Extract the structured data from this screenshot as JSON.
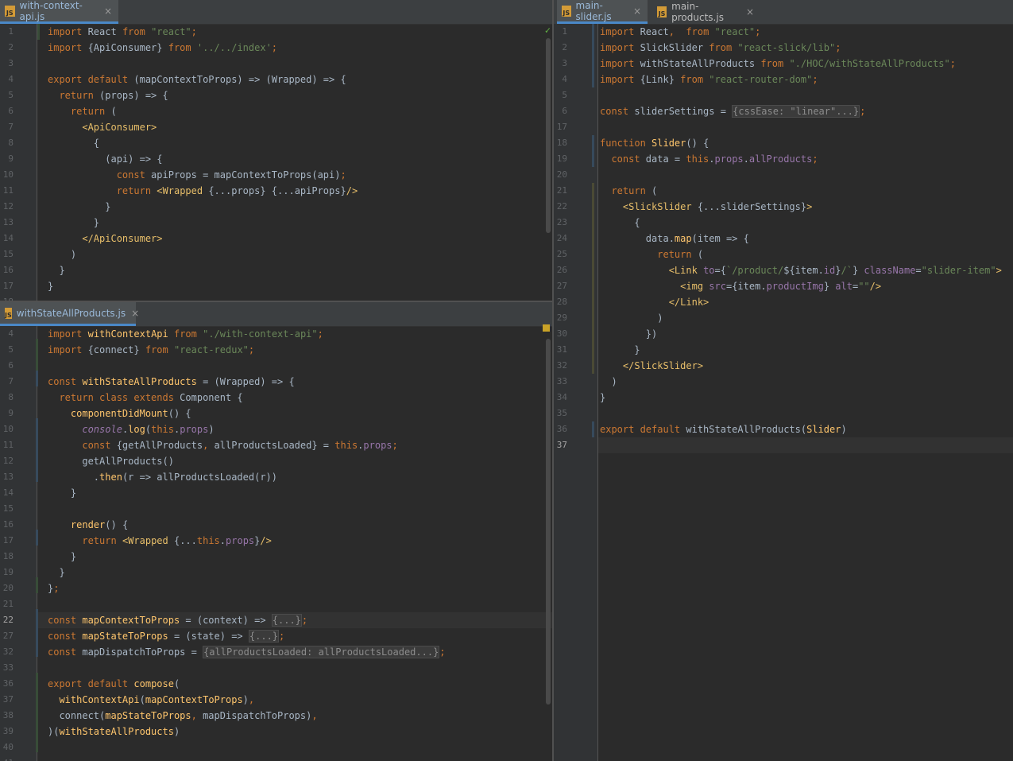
{
  "left_top": {
    "tab": {
      "filename": "with-context-api.js",
      "close": "×"
    },
    "check_mark": "✓",
    "lines": [
      {
        "n": "1",
        "h": "<span class='k'>import</span> React <span class='k'>from</span> <span class='s'>\"react\"</span><span class='k'>;</span>"
      },
      {
        "n": "2",
        "h": "<span class='k'>import</span> {ApiConsumer} <span class='k'>from</span> <span class='s'>'../../index'</span><span class='k'>;</span>"
      },
      {
        "n": "3",
        "h": ""
      },
      {
        "n": "4",
        "h": "<span class='k'>export default</span> (mapContextToProps) => (Wrapped) => {"
      },
      {
        "n": "5",
        "h": "  <span class='k'>return</span> (props) => {"
      },
      {
        "n": "6",
        "h": "    <span class='k'>return</span> ("
      },
      {
        "n": "7",
        "h": "      <span class='t'>&lt;ApiConsumer&gt;</span>"
      },
      {
        "n": "8",
        "h": "        {"
      },
      {
        "n": "9",
        "h": "          (api) => {"
      },
      {
        "n": "10",
        "h": "            <span class='k'>const</span> apiProps = mapContextToProps(api)<span class='k'>;</span>"
      },
      {
        "n": "11",
        "h": "            <span class='k'>return</span> <span class='t'>&lt;Wrapped</span> {...props} {...apiProps}<span class='t'>/&gt;</span>"
      },
      {
        "n": "12",
        "h": "          }"
      },
      {
        "n": "13",
        "h": "        }"
      },
      {
        "n": "14",
        "h": "      <span class='t'>&lt;/ApiConsumer&gt;</span>"
      },
      {
        "n": "15",
        "h": "    )"
      },
      {
        "n": "16",
        "h": "  }"
      },
      {
        "n": "17",
        "h": "}"
      },
      {
        "n": "18",
        "h": ""
      }
    ]
  },
  "left_bottom": {
    "tab": {
      "filename": "withStateAllProducts.js",
      "close": "×"
    },
    "lines": [
      {
        "n": "4",
        "h": "<span class='k'>import</span> <span class='fn'>withContextApi</span> <span class='k'>from</span> <span class='s'>\"./with-context-api\"</span><span class='k'>;</span>"
      },
      {
        "n": "5",
        "h": "<span class='k'>import</span> {connect} <span class='k'>from</span> <span class='s'>\"react-redux\"</span><span class='k'>;</span>"
      },
      {
        "n": "6",
        "h": ""
      },
      {
        "n": "7",
        "h": "<span class='k'>const</span> <span class='fn'>withStateAllProducts</span> = (Wrapped) => {"
      },
      {
        "n": "8",
        "h": "  <span class='k'>return class extends</span> Component {"
      },
      {
        "n": "9",
        "h": "    <span class='fn'>componentDidMount</span>() {"
      },
      {
        "n": "10",
        "h": "      <span class='it'>console</span>.<span class='fn'>log</span>(<span class='k'>this</span>.<span class='p'>props</span>)"
      },
      {
        "n": "11",
        "h": "      <span class='k'>const</span> {getAllProducts<span class='k'>,</span> allProductsLoaded} = <span class='k'>this</span>.<span class='p'>props</span><span class='k'>;</span>"
      },
      {
        "n": "12",
        "h": "      getAllProducts()"
      },
      {
        "n": "13",
        "h": "        .<span class='fn'>then</span>(r => allProductsLoaded(r))"
      },
      {
        "n": "14",
        "h": "    }"
      },
      {
        "n": "15",
        "h": ""
      },
      {
        "n": "16",
        "h": "    <span class='fn'>render</span>() {"
      },
      {
        "n": "17",
        "h": "      <span class='k'>return</span> <span class='t'>&lt;Wrapped</span> {...<span class='k'>this</span>.<span class='p'>props</span>}<span class='t'>/&gt;</span>"
      },
      {
        "n": "18",
        "h": "    }"
      },
      {
        "n": "19",
        "h": "  }"
      },
      {
        "n": "20",
        "h": "}<span class='k'>;</span>"
      },
      {
        "n": "21",
        "h": ""
      },
      {
        "n": "22",
        "h": "<span class='k'>const</span> <span class='fn'>mapContextToProps</span> = (context) => <span class='fold'>{...}</span><span class='k'>;</span>",
        "current": true
      },
      {
        "n": "27",
        "h": "<span class='k'>const</span> <span class='fn'>mapStateToProps</span> = (state) => <span class='fold'>{...}</span><span class='k'>;</span>"
      },
      {
        "n": "32",
        "h": "<span class='k'>const</span> mapDispatchToProps = <span class='fold'>{allProductsLoaded: allProductsLoaded...}</span><span class='k'>;</span>"
      },
      {
        "n": "33",
        "h": ""
      },
      {
        "n": "36",
        "h": "<span class='k'>export default</span> <span class='fn'>compose</span>("
      },
      {
        "n": "37",
        "h": "  <span class='fn'>withContextApi</span>(<span class='fn'>mapContextToProps</span>)<span class='k'>,</span>"
      },
      {
        "n": "38",
        "h": "  connect(<span class='fn'>mapStateToProps</span><span class='k'>,</span> mapDispatchToProps)<span class='k'>,</span>"
      },
      {
        "n": "39",
        "h": ")(<span class='fn'>withStateAllProducts</span>)"
      },
      {
        "n": "40",
        "h": ""
      },
      {
        "n": "41",
        "h": ""
      }
    ]
  },
  "right": {
    "tabs": [
      {
        "filename": "main-slider.js",
        "close": "×"
      },
      {
        "filename": "main-products.js",
        "close": "×"
      }
    ],
    "lines": [
      {
        "n": "1",
        "h": "<span class='k'>import</span> React<span class='k'>,</span>  <span class='k'>from</span> <span class='s'>\"react\"</span><span class='k'>;</span>"
      },
      {
        "n": "2",
        "h": "<span class='k'>import</span> SlickSlider <span class='k'>from</span> <span class='s'>\"react-slick/lib\"</span><span class='k'>;</span>"
      },
      {
        "n": "3",
        "h": "<span class='k'>import</span> withStateAllProducts <span class='k'>from</span> <span class='s'>\"./HOC/withStateAllProducts\"</span><span class='k'>;</span>"
      },
      {
        "n": "4",
        "h": "<span class='k'>import</span> {Link} <span class='k'>from</span> <span class='s'>\"react-router-dom\"</span><span class='k'>;</span>"
      },
      {
        "n": "5",
        "h": ""
      },
      {
        "n": "6",
        "h": "<span class='k'>const</span> sliderSettings = <span class='fold'>{cssEase: \"linear\"...}</span><span class='k'>;</span>"
      },
      {
        "n": "17",
        "h": ""
      },
      {
        "n": "18",
        "h": "<span class='k'>function</span> <span class='fn'>Slider</span>() {"
      },
      {
        "n": "19",
        "h": "  <span class='k'>const</span> data = <span class='k'>this</span>.<span class='p'>props</span>.<span class='p'>allProducts</span><span class='k'>;</span>"
      },
      {
        "n": "20",
        "h": ""
      },
      {
        "n": "21",
        "h": "  <span class='k'>return</span> ("
      },
      {
        "n": "22",
        "h": "    <span class='t'>&lt;SlickSlider</span> {...sliderSettings}<span class='t'>&gt;</span>"
      },
      {
        "n": "23",
        "h": "      {"
      },
      {
        "n": "24",
        "h": "        data.<span class='fn'>map</span>(item => {"
      },
      {
        "n": "25",
        "h": "          <span class='k'>return</span> ("
      },
      {
        "n": "26",
        "h": "            <span class='t'>&lt;Link</span> <span class='p'>to</span>={<span class='s'>`/product/</span>${item.<span class='p'>id</span>}<span class='s'>/`</span>} <span class='p'>className</span>=<span class='s'>\"slider-item\"</span><span class='t'>&gt;</span>"
      },
      {
        "n": "27",
        "h": "              <span class='t'>&lt;img</span> <span class='p'>src</span>={item.<span class='p'>productImg</span>} <span class='p'>alt</span>=<span class='s'>\"\"</span><span class='t'>/&gt;</span>"
      },
      {
        "n": "28",
        "h": "            <span class='t'>&lt;/Link&gt;</span>"
      },
      {
        "n": "29",
        "h": "          )"
      },
      {
        "n": "30",
        "h": "        })"
      },
      {
        "n": "31",
        "h": "      }"
      },
      {
        "n": "32",
        "h": "    <span class='t'>&lt;/SlickSlider&gt;</span>"
      },
      {
        "n": "33",
        "h": "  )"
      },
      {
        "n": "34",
        "h": "}"
      },
      {
        "n": "35",
        "h": ""
      },
      {
        "n": "36",
        "h": "<span class='k'>export default</span> withStateAllProducts(<span class='fn'>Slider</span>)"
      },
      {
        "n": "37",
        "h": "",
        "current": true
      }
    ]
  },
  "colors": {
    "editor_bg": "#2b2b2b",
    "gutter_bg": "#313335",
    "tab_active_accent": "#4a88c7",
    "keyword": "#cc7832",
    "string": "#6a8759",
    "function": "#ffc66d",
    "property": "#9876aa",
    "tag": "#e8bf6a"
  }
}
